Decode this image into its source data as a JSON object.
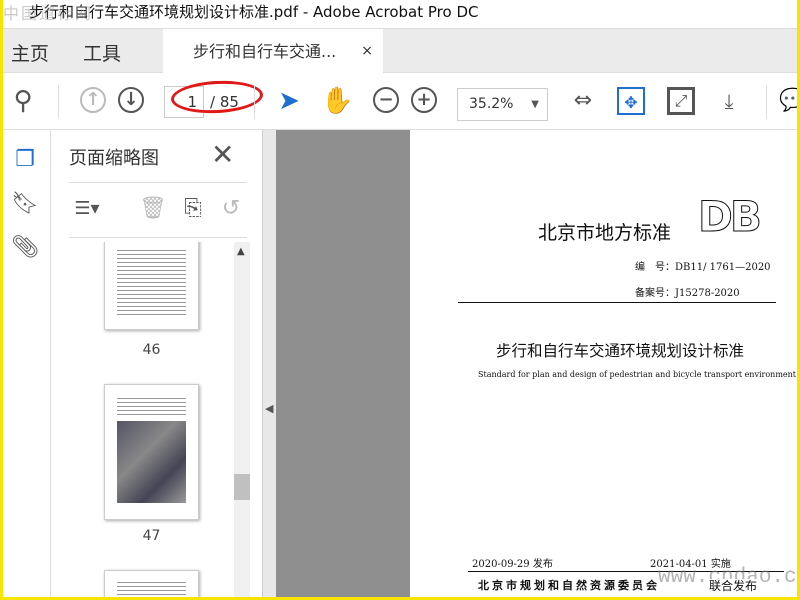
{
  "window": {
    "title": "步行和自行车交通环境规划设计标准.pdf - Adobe Acrobat Pro DC",
    "watermark": "中国道标网"
  },
  "nav": {
    "home": "主页",
    "tools": "工具",
    "doc_tab": "步行和自行车交通...",
    "close": "×"
  },
  "toolbar": {
    "page_current": "1",
    "page_total": "/ 85",
    "zoom": "35.2%"
  },
  "panel": {
    "title": "页面缩略图",
    "pages": [
      "46",
      "47"
    ]
  },
  "document": {
    "org_title": "北京市地方标准",
    "logo": "DB",
    "code_label": "编　号：",
    "code": "DB11/  1761—2020",
    "record_label": "备案号：",
    "record": "J15278-2020",
    "title_cn": "步行和自行车交通环境规划设计标准",
    "title_en": "Standard for plan and design of pedestrian and bicycle transport environment",
    "issue_date": "2020-09-29 发布",
    "effective_date": "2021-04-01 实施",
    "issuer": "北京市规划和自然资源委员会",
    "issuer2": "联合发布",
    "watermark": "www.cndao.com"
  },
  "colors": {
    "accent": "#1f6fcf",
    "highlight": "#e01818",
    "border": "#f7e400"
  }
}
